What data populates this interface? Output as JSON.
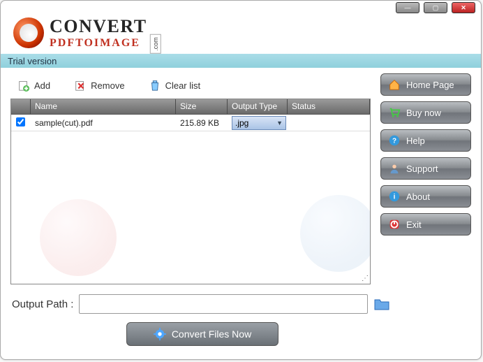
{
  "brand": {
    "line1": "CONVERT",
    "line2": "PDFTOIMAGE",
    "suffix": ".com"
  },
  "trial": "Trial version",
  "toolbar": {
    "add": "Add",
    "remove": "Remove",
    "clear": "Clear list"
  },
  "grid": {
    "headers": {
      "name": "Name",
      "size": "Size",
      "output": "Output Type",
      "status": "Status"
    },
    "rows": [
      {
        "checked": true,
        "name": "sample(cut).pdf",
        "size": "215.89 KB",
        "output": ".jpg",
        "status": ""
      }
    ]
  },
  "output": {
    "label": "Output Path :",
    "value": ""
  },
  "convert": "Convert Files Now",
  "sidebar": {
    "home": "Home Page",
    "buy": "Buy now",
    "help": "Help",
    "support": "Support",
    "about": "About",
    "exit": "Exit"
  }
}
